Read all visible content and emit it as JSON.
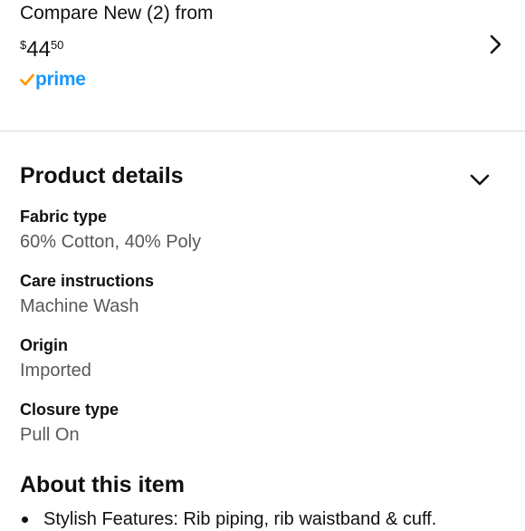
{
  "offer": {
    "compare_text": "Compare New (2) from",
    "price": {
      "symbol": "$",
      "whole": "44",
      "fraction": "50"
    },
    "prime_label": "prime",
    "prime_check_color": "#ff9900",
    "prime_text_color": "#1a98ff",
    "chevron_icon": "chevron-right-icon"
  },
  "product_details": {
    "title": "Product details",
    "toggle_icon": "chevron-down-icon",
    "items": [
      {
        "label": "Fabric type",
        "value": "60% Cotton, 40% Poly"
      },
      {
        "label": "Care instructions",
        "value": "Machine Wash"
      },
      {
        "label": "Origin",
        "value": "Imported"
      },
      {
        "label": "Closure type",
        "value": "Pull On"
      }
    ]
  },
  "about": {
    "title": "About this item",
    "bullets": [
      "Stylish Features: Rib piping, rib waistband & cuff."
    ]
  },
  "colors": {
    "text_primary": "#0f1111",
    "text_secondary": "#565959",
    "divider": "#d5d9d9"
  }
}
